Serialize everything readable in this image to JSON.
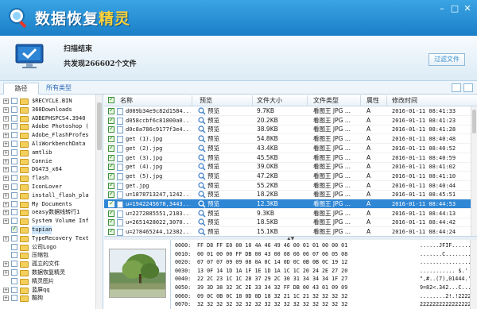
{
  "app": {
    "title": "数据恢复精灵",
    "title_part1": "数据恢复",
    "title_part2": "精灵",
    "window_buttons": [
      "–",
      "□",
      "✕"
    ]
  },
  "status": {
    "title": "扫描结束",
    "summary": "共发现266602个文件",
    "filter_button": "过滤文件"
  },
  "tabs": {
    "path": "路径",
    "all_types": "所有类型"
  },
  "tree": {
    "items": [
      {
        "label": "$RECYCLE.BIN",
        "checked": false,
        "expander": "+"
      },
      {
        "label": "360Downloads",
        "checked": false,
        "expander": "+"
      },
      {
        "label": "ADBEPHSPCS4.3940",
        "checked": false,
        "expander": "+"
      },
      {
        "label": "Adobe Photoshop (",
        "checked": false,
        "expander": "+"
      },
      {
        "label": "Adobe_FlashProfes",
        "checked": false,
        "expander": "+"
      },
      {
        "label": "AliWorkbenchData",
        "checked": false,
        "expander": "+"
      },
      {
        "label": "amtlib",
        "checked": false,
        "expander": "+"
      },
      {
        "label": "Connie",
        "checked": false,
        "expander": "+"
      },
      {
        "label": "DG473_x64",
        "checked": false,
        "expander": "+"
      },
      {
        "label": "flash",
        "checked": false,
        "expander": "+"
      },
      {
        "label": "IconLover",
        "checked": false,
        "expander": "+"
      },
      {
        "label": "install_flash_pla",
        "checked": false,
        "expander": "+"
      },
      {
        "label": "My Documents",
        "checked": false,
        "expander": "+"
      },
      {
        "label": "oeasy数据线转行1",
        "checked": false,
        "expander": "+"
      },
      {
        "label": "System Volume Inf",
        "checked": false,
        "expander": "+"
      },
      {
        "label": "tupian",
        "checked": true,
        "expander": "",
        "selected": true
      },
      {
        "label": "TypeRecovery Text",
        "checked": false,
        "expander": "+"
      },
      {
        "label": "公司Logo",
        "checked": false,
        "expander": ""
      },
      {
        "label": "压缩包",
        "checked": false,
        "expander": ""
      },
      {
        "label": "孤立的文件",
        "checked": false,
        "expander": "+"
      },
      {
        "label": "数据恢复精灵",
        "checked": false,
        "expander": "+"
      },
      {
        "label": "精灵图片",
        "checked": false,
        "expander": ""
      },
      {
        "label": "蓝屏qq",
        "checked": false,
        "expander": "+"
      },
      {
        "label": "酷狗",
        "checked": false,
        "expander": "+"
      }
    ]
  },
  "table": {
    "columns": [
      "名称",
      "预览",
      "文件大小",
      "文件类型",
      "属性",
      "修改时间"
    ],
    "preview_label": "预览",
    "rows": [
      {
        "name": "d009b34e9c82d1584...",
        "size": "9.7KB",
        "type": "看图王 JPG ...",
        "attr": "A",
        "mtime": "2016-01-11 08:41:33",
        "selected": false
      },
      {
        "name": "d058ccbf6c81800a0...",
        "size": "20.2KB",
        "type": "看图王 JPG ...",
        "attr": "A",
        "mtime": "2016-01-11 08:41:23",
        "selected": false
      },
      {
        "name": "d0c8a786c9177f3e4...",
        "size": "38.9KB",
        "type": "看图王 JPG ...",
        "attr": "A",
        "mtime": "2016-01-11 08:41:28",
        "selected": false
      },
      {
        "name": "get (1).jpg",
        "size": "54.8KB",
        "type": "看图王 JPG ...",
        "attr": "A",
        "mtime": "2016-01-11 08:40:48",
        "selected": false
      },
      {
        "name": "get (2).jpg",
        "size": "43.4KB",
        "type": "看图王 JPG ...",
        "attr": "A",
        "mtime": "2016-01-11 08:40:52",
        "selected": false
      },
      {
        "name": "get (3).jpg",
        "size": "45.5KB",
        "type": "看图王 JPG ...",
        "attr": "A",
        "mtime": "2016-01-11 08:40:59",
        "selected": false
      },
      {
        "name": "get (4).jpg",
        "size": "39.0KB",
        "type": "看图王 JPG ...",
        "attr": "A",
        "mtime": "2016-01-11 08:41:02",
        "selected": false
      },
      {
        "name": "get (5).jpg",
        "size": "47.2KB",
        "type": "看图王 JPG ...",
        "attr": "A",
        "mtime": "2016-01-11 08:41:10",
        "selected": false
      },
      {
        "name": "get.jpg",
        "size": "55.2KB",
        "type": "看图王 JPG ...",
        "attr": "A",
        "mtime": "2016-01-11 08:40:44",
        "selected": false
      },
      {
        "name": "u=1878713247,1242...",
        "size": "18.2KB",
        "type": "看图王 JPG ...",
        "attr": "A",
        "mtime": "2016-01-11 08:45:51",
        "selected": false
      },
      {
        "name": "u=1942245678,3443...",
        "size": "12.3KB",
        "type": "看图王 JPG ...",
        "attr": "A",
        "mtime": "2016-01-11 08:44:53",
        "selected": true
      },
      {
        "name": "u=2272885551,2183...",
        "size": "9.3KB",
        "type": "看图王 JPG ...",
        "attr": "A",
        "mtime": "2016-01-11 08:44:13",
        "selected": false
      },
      {
        "name": "u=2651428022,3070...",
        "size": "18.5KB",
        "type": "看图王 JPG ...",
        "attr": "A",
        "mtime": "2016-01-11 08:44:42",
        "selected": false
      },
      {
        "name": "u=278465244,12382...",
        "size": "15.1KB",
        "type": "看图王 JPG ...",
        "attr": "A",
        "mtime": "2016-01-11 08:44:24",
        "selected": false
      }
    ]
  },
  "hex": {
    "rows": [
      {
        "offset": "0000:",
        "bytes": "FF D8 FF E0 00 10 4A 46 49 46 00 01 01 00 00 01",
        "ascii": "......JFIF......"
      },
      {
        "offset": "0010:",
        "bytes": "00 01 00 00 FF DB 00 43 00 08 06 06 07 06 05 08",
        "ascii": ".......C........"
      },
      {
        "offset": "0020:",
        "bytes": "07 07 07 09 09 08 0A 0C 14 0D 0C 0B 0B 0C 19 12",
        "ascii": "................"
      },
      {
        "offset": "0030:",
        "bytes": "13 0F 14 1D 1A 1F 1E 1D 1A 1C 1C 20 24 2E 27 20",
        "ascii": "........... $.' "
      },
      {
        "offset": "0040:",
        "bytes": "22 2C 23 1C 1C 28 37 29 2C 30 31 34 34 34 1F 27",
        "ascii": "\",#..(7),01444.'"
      },
      {
        "offset": "0050:",
        "bytes": "39 3D 38 32 3C 2E 33 34 32 FF DB 00 43 01 09 09",
        "ascii": "9=82<.342...C..."
      },
      {
        "offset": "0060:",
        "bytes": "09 0C 0B 0C 18 0D 0D 18 32 21 1C 21 32 32 32 32",
        "ascii": "........2!.!2222"
      },
      {
        "offset": "0070:",
        "bytes": "32 32 32 32 32 32 32 32 32 32 32 32 32 32 32 32",
        "ascii": "2222222222222222"
      }
    ]
  },
  "colors": {
    "titlebar": "#2290d6",
    "accent": "#ffd23a",
    "selection": "#2f86d4",
    "link": "#2a69b8"
  }
}
